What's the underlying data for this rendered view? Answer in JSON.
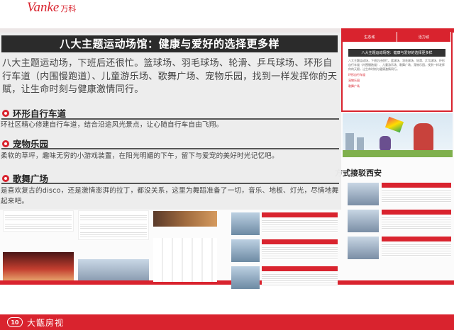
{
  "header": {
    "logo_latin": "Vanke",
    "logo_cn": "万科"
  },
  "footer": {
    "mark": "10",
    "name": "大甑房视"
  },
  "panel": {
    "title": "八大主题运动场馆：健康与爱好的选择更多样",
    "intro": "八大主题运动场，下班后还很忙。篮球场、羽毛球场、轮滑、乒乓球场、环形自行车道（内围慢跑道）、儿童游乐场、歌舞广场、宠物乐园，找到一样发挥你的天赋，让生命时刻与健康激情同行。",
    "sections": [
      {
        "label": "环形自行车道",
        "text": "环社区精心修建自行车道，结合沿途风光景点，让心随自行车自由飞翔。"
      },
      {
        "label": "宠物乐园",
        "text": "柔软的草坪，趣味无穷的小游戏装置，在阳光明媚的下午，留下与爱宠的美好时光记忆吧。"
      },
      {
        "label": "歌舞广场",
        "text": "是喜欢复古的disco，还是激情澎湃的拉丁，都没关系，这里为舞蹈准备了一切，音乐、地板、灯光，尽情地舞起来吧。"
      }
    ]
  },
  "right_column": {
    "mini_tabs": [
      "生态城",
      "活力城"
    ],
    "mini_title": "八大主题运动场馆：健康与爱好的选择更多样",
    "mini_subs": [
      "环形自行车道",
      "宠物乐园",
      "歌舞广场"
    ],
    "west_heading": "方式接驳西安"
  },
  "icons": {
    "section_bullet": "red-ring-bullet-icon"
  },
  "colors": {
    "accent": "#d9232e",
    "title_bar": "#2b2b2b",
    "panel_bg": "#ececec"
  }
}
